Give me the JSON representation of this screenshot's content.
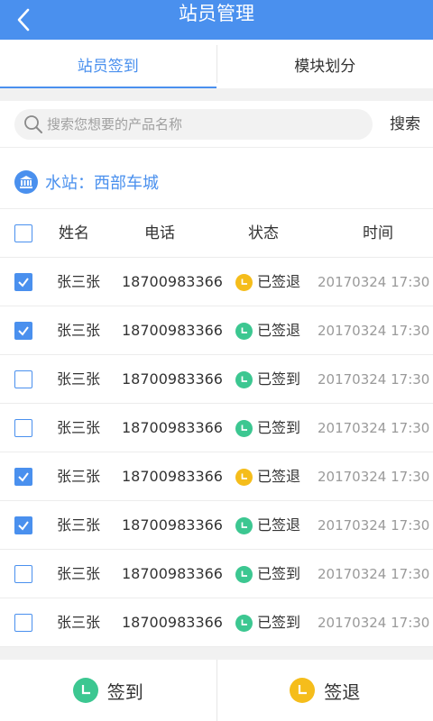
{
  "header": {
    "title": "站员管理",
    "back_icon": "chevron-left-icon"
  },
  "tabs": [
    {
      "label": "站员签到",
      "active": true
    },
    {
      "label": "模块划分",
      "active": false
    }
  ],
  "search": {
    "placeholder": "搜索您想要的产品名称",
    "value": "",
    "button_label": "搜索"
  },
  "station": {
    "label": "水站：西部车城",
    "icon": "building-icon"
  },
  "table": {
    "headers": {
      "name": "姓名",
      "phone": "电话",
      "status": "状态",
      "time": "时间"
    },
    "rows": [
      {
        "checked": true,
        "name": "张三张",
        "phone": "18700983366",
        "status": "已签退",
        "status_type": "out",
        "time": "20170324 17:30"
      },
      {
        "checked": true,
        "name": "张三张",
        "phone": "18700983366",
        "status": "已签退",
        "status_type": "in",
        "time": "20170324 17:30"
      },
      {
        "checked": false,
        "name": "张三张",
        "phone": "18700983366",
        "status": "已签到",
        "status_type": "in",
        "time": "20170324 17:30"
      },
      {
        "checked": false,
        "name": "张三张",
        "phone": "18700983366",
        "status": "已签到",
        "status_type": "in",
        "time": "20170324 17:30"
      },
      {
        "checked": true,
        "name": "张三张",
        "phone": "18700983366",
        "status": "已签退",
        "status_type": "out",
        "time": "20170324 17:30"
      },
      {
        "checked": true,
        "name": "张三张",
        "phone": "18700983366",
        "status": "已签退",
        "status_type": "in",
        "time": "20170324 17:30"
      },
      {
        "checked": false,
        "name": "张三张",
        "phone": "18700983366",
        "status": "已签到",
        "status_type": "in",
        "time": "20170324 17:30"
      },
      {
        "checked": false,
        "name": "张三张",
        "phone": "18700983366",
        "status": "已签到",
        "status_type": "in",
        "time": "20170324 17:30"
      }
    ]
  },
  "actions": {
    "sign_in_label": "签到",
    "sign_out_label": "签退"
  },
  "colors": {
    "primary": "#4a90ee",
    "status_in": "#3cc791",
    "status_out": "#f5bd1b"
  }
}
